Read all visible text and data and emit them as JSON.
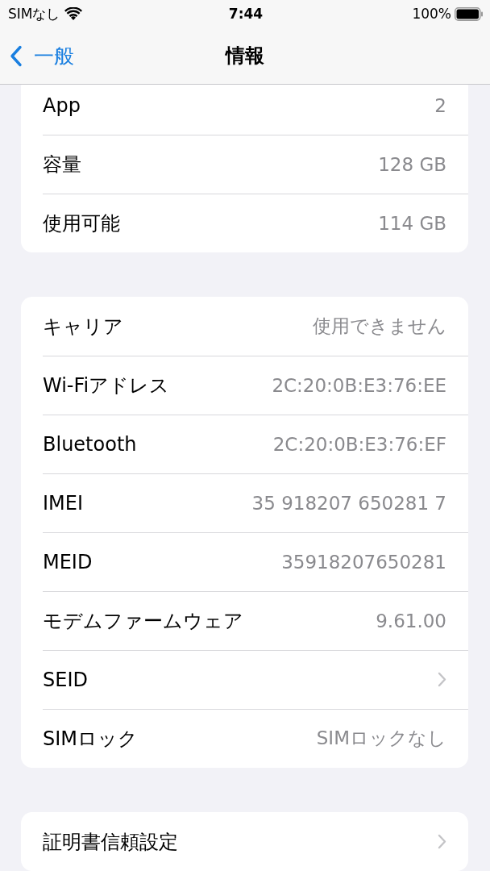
{
  "status_bar": {
    "carrier": "SIMなし",
    "time": "7:44",
    "battery": "100%"
  },
  "nav": {
    "back": "一般",
    "title": "情報"
  },
  "groups": [
    {
      "rows": [
        {
          "kind": "value",
          "label": "App",
          "value": "2"
        },
        {
          "kind": "value",
          "label": "容量",
          "value": "128 GB"
        },
        {
          "kind": "value",
          "label": "使用可能",
          "value": "114 GB"
        }
      ]
    },
    {
      "rows": [
        {
          "kind": "value",
          "label": "キャリア",
          "value": "使用できません"
        },
        {
          "kind": "value",
          "label": "Wi-Fiアドレス",
          "value": "2C:20:0B:E3:76:EE"
        },
        {
          "kind": "value",
          "label": "Bluetooth",
          "value": "2C:20:0B:E3:76:EF"
        },
        {
          "kind": "value",
          "label": "IMEI",
          "value": "35 918207 650281 7"
        },
        {
          "kind": "value",
          "label": "MEID",
          "value": "35918207650281"
        },
        {
          "kind": "value",
          "label": "モデムファームウェア",
          "value": "9.61.00"
        },
        {
          "kind": "disclosure",
          "label": "SEID"
        },
        {
          "kind": "value",
          "label": "SIMロック",
          "value": "SIMロックなし"
        }
      ]
    },
    {
      "rows": [
        {
          "kind": "disclosure",
          "label": "証明書信頼設定"
        }
      ]
    }
  ]
}
